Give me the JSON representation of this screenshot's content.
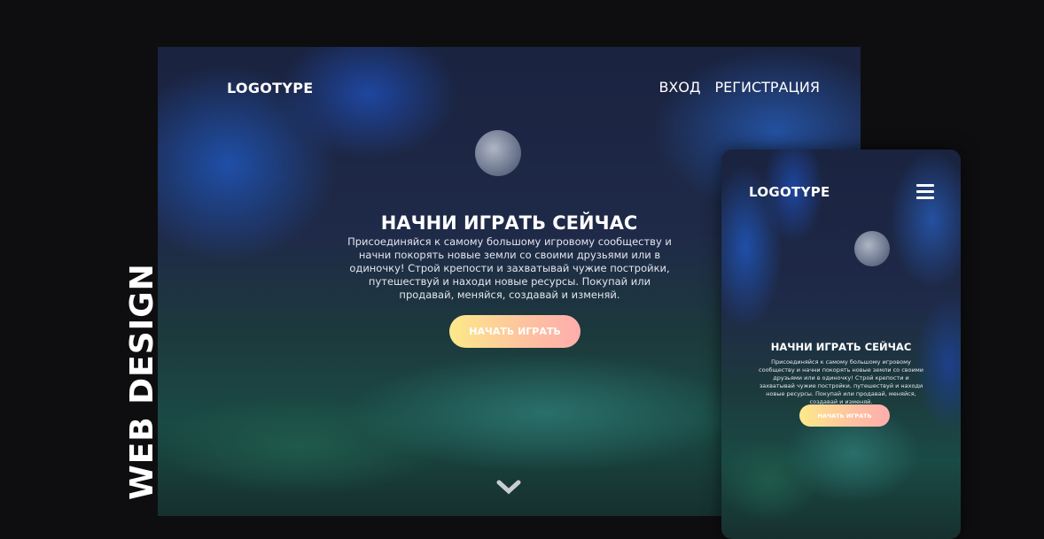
{
  "side_label": "WEB DESIGN",
  "desktop": {
    "logo": "LOGOTYPE",
    "nav": [
      "ВХОД",
      "РЕГИСТРАЦИЯ"
    ],
    "title": "НАЧНИ ИГРАТЬ СЕЙЧАС",
    "text": "Присоединяйся к самому большому игровому сообществу и начни покорять новые земли со своими друзьями или в одиночку! Строй крепости и захватывай чужие постройки, путешествуй и находи новые ресурсы. Покупай или продавай, меняйся, создавай и изменяй.",
    "cta": "НАЧАТЬ ИГРАТЬ",
    "scroll_icon": "chevron-down-icon"
  },
  "mobile": {
    "logo": "LOGOTYPE",
    "menu_icon": "hamburger-menu-icon",
    "title": "НАЧНИ ИГРАТЬ СЕЙЧАС",
    "text": "Присоединяйся к самому большому игровому сообществу и начни покорять новые земли со своими друзьями или в одиночку! Строй крепости и захватывай чужие постройки, путешествуй и находи новые ресурсы. Покупай или продавай, меняйся, создавай и изменяй.",
    "cta": "НАЧАТЬ ИГРАТЬ"
  },
  "colors": {
    "background": "#0e0e10",
    "cta_start": "#fde98a",
    "cta_end": "#ffadad"
  }
}
